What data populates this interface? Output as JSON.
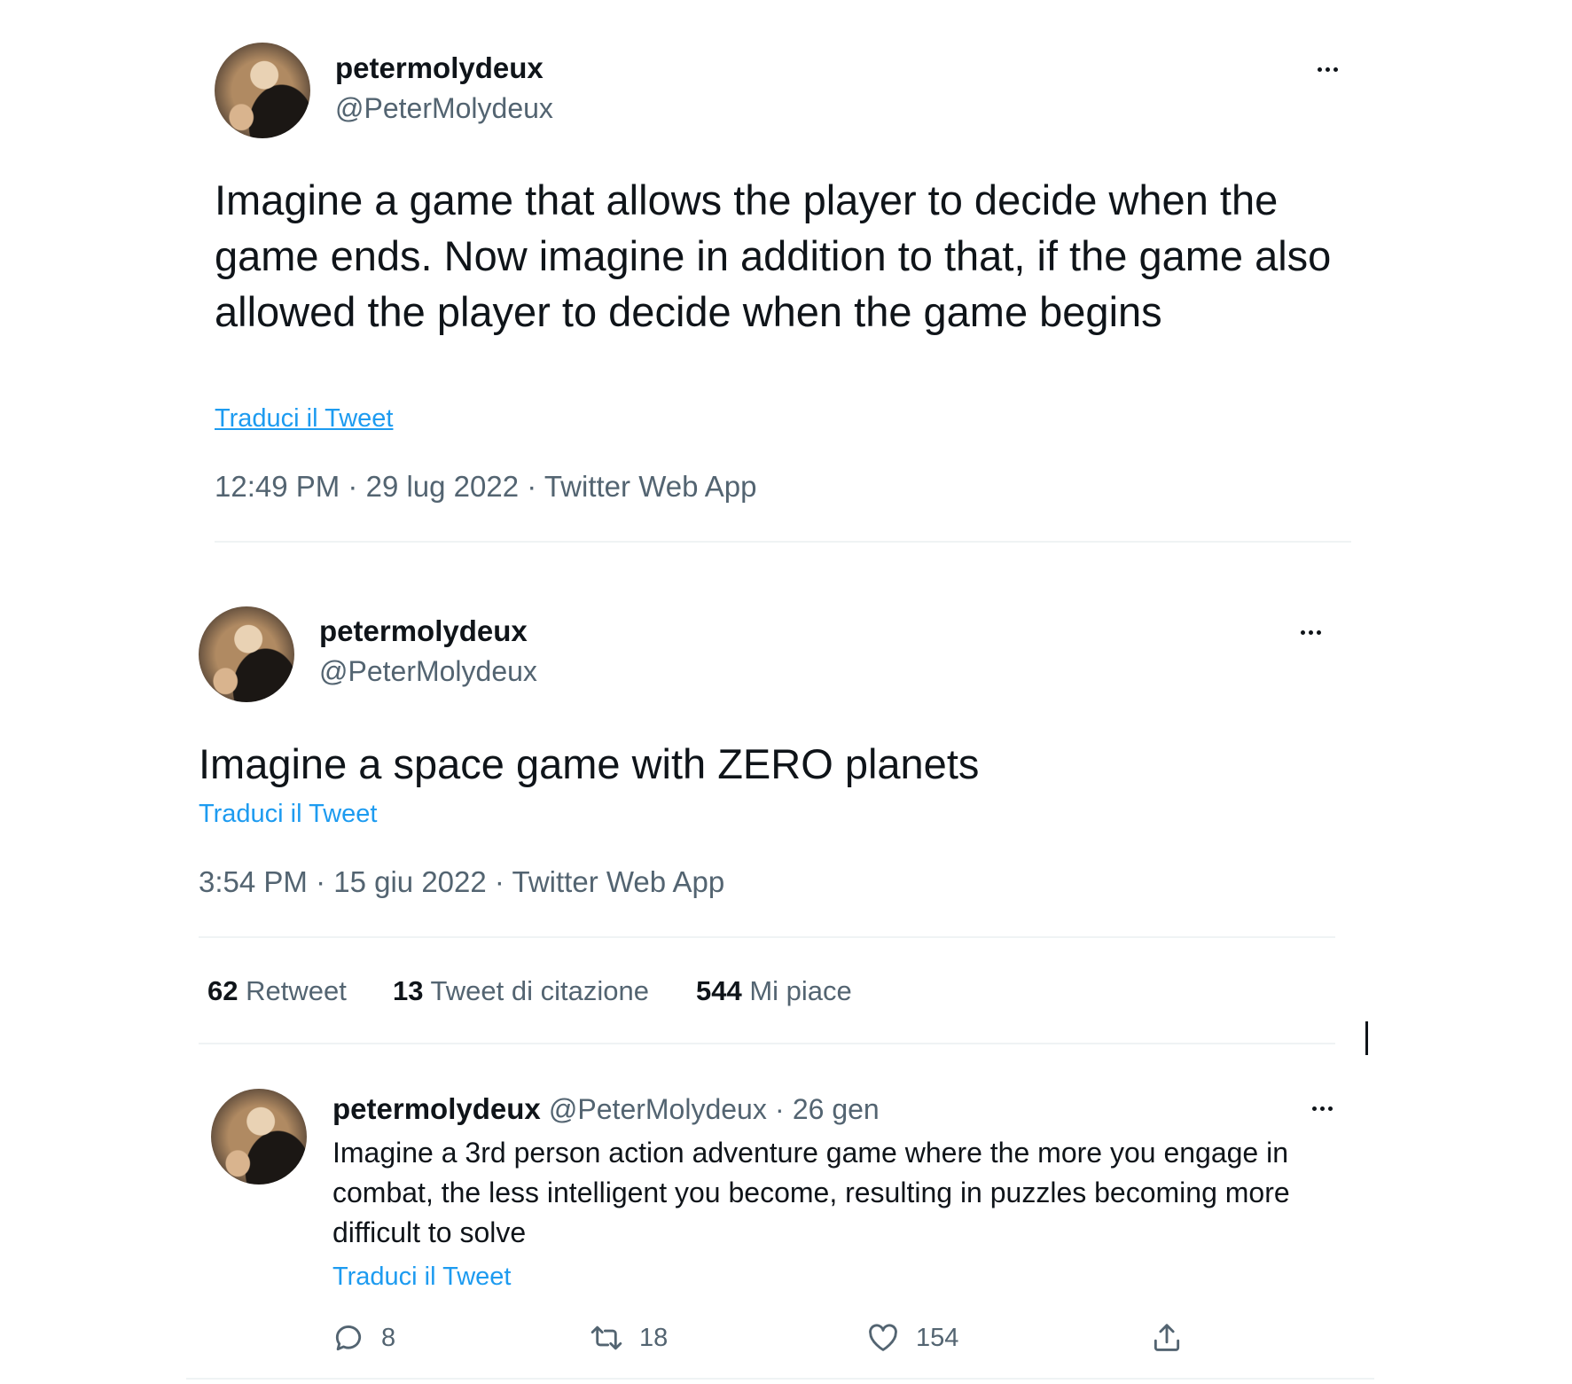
{
  "tweet1": {
    "name": "petermolydeux",
    "handle": "@PeterMolydeux",
    "text": "Imagine a game that allows the player to decide when the game ends. Now imagine in addition to that, if the game also allowed the player to decide when the game begins",
    "translate": "Traduci il Tweet",
    "time": "12:49 PM",
    "date": "29 lug 2022",
    "source": "Twitter Web App"
  },
  "tweet2": {
    "name": "petermolydeux",
    "handle": "@PeterMolydeux",
    "text": "Imagine a space game with ZERO planets",
    "translate": "Traduci il Tweet",
    "time": "3:54 PM",
    "date": "15 giu 2022",
    "source": "Twitter Web App",
    "stats": [
      {
        "count": "62",
        "label": "Retweet"
      },
      {
        "count": "13",
        "label": "Tweet di citazione"
      },
      {
        "count": "544",
        "label": "Mi piace"
      }
    ]
  },
  "reply": {
    "name": "petermolydeux",
    "handle": "@PeterMolydeux",
    "date": "26 gen",
    "text": "Imagine a 3rd person action adventure game where the more you engage in combat, the less intelligent you become, resulting in puzzles becoming more difficult to solve",
    "translate": "Traduci il Tweet",
    "actions": {
      "replies": "8",
      "retweets": "18",
      "likes": "154"
    }
  },
  "separator": "·",
  "icons": [
    "more-icon",
    "reply-icon",
    "retweet-icon",
    "like-icon",
    "share-icon"
  ]
}
